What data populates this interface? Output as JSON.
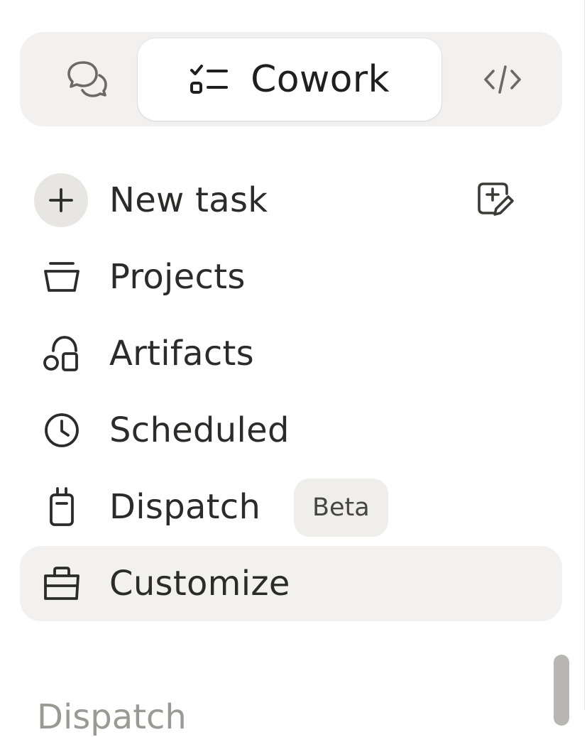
{
  "mode_switch": {
    "modes": [
      {
        "icon": "chat-bubbles-icon",
        "label": ""
      },
      {
        "icon": "task-list-icon",
        "label": "Cowork",
        "active": true
      },
      {
        "icon": "code-icon",
        "label": ""
      }
    ],
    "active_label": "Cowork"
  },
  "nav": {
    "new_task": "New task",
    "projects": "Projects",
    "artifacts": "Artifacts",
    "scheduled": "Scheduled",
    "dispatch": "Dispatch",
    "dispatch_badge": "Beta",
    "customize": "Customize"
  },
  "section": {
    "heading": "Dispatch"
  },
  "colors": {
    "switch_bg": "#f2f1ef",
    "selected_bg": "#f2f1ef",
    "text": "#2b2b29",
    "muted": "#9a9994"
  }
}
